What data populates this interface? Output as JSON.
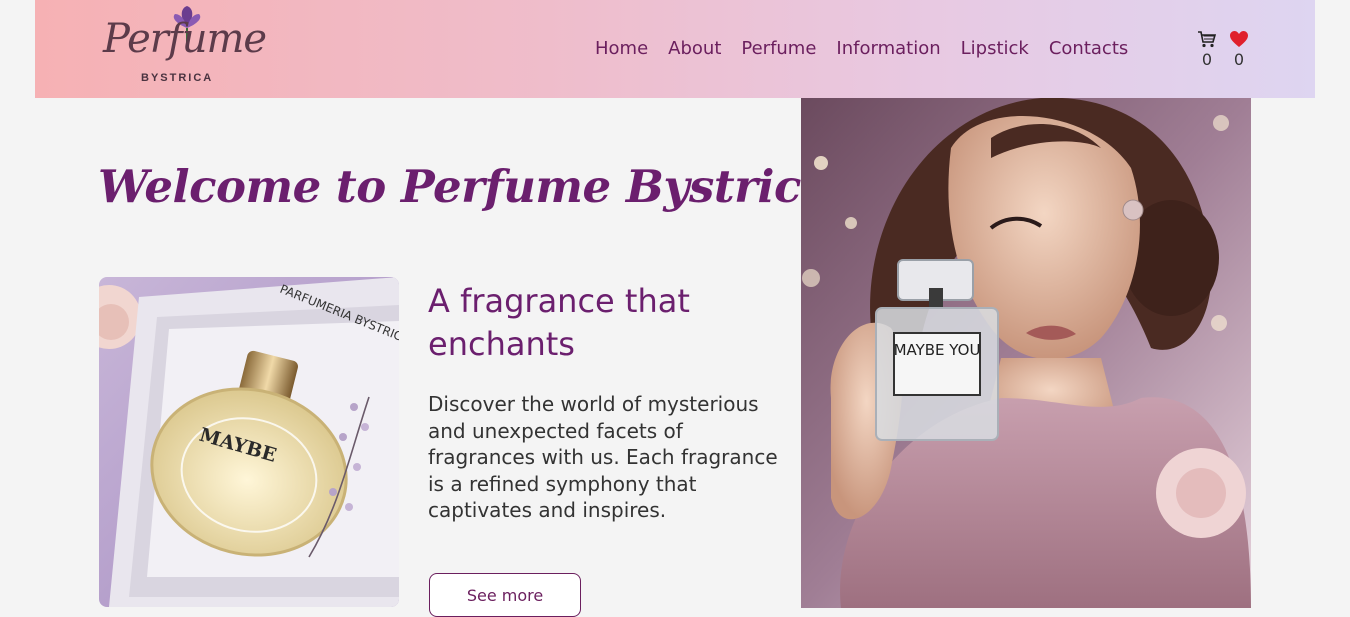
{
  "logo": {
    "script": "Perfume",
    "sub": "BYSTRICA"
  },
  "nav": {
    "items": [
      "Home",
      "About",
      "Perfume",
      "Information",
      "Lipstick",
      "Contacts"
    ]
  },
  "icons": {
    "cart": {
      "name": "cart-icon",
      "count": "0"
    },
    "wishlist": {
      "name": "heart-icon",
      "count": "0"
    }
  },
  "main": {
    "welcome": "Welcome to Perfume Bystrica!",
    "headline": "A fragrance that enchants",
    "description": "Discover the world of mysterious and unexpected facets of fragrances with us. Each fragrance is a refined symphony that captivates and inspires.",
    "see_more": "See more"
  },
  "product_image": {
    "box_text": "PARFUMERIA BYSTRICA",
    "bottle_label": "MAYBE"
  },
  "hero_image": {
    "bottle_label": "MAYBE YOU"
  },
  "colors": {
    "accent": "#6b1f6e",
    "nav": "#6b1f5e",
    "heart": "#e0202c"
  }
}
